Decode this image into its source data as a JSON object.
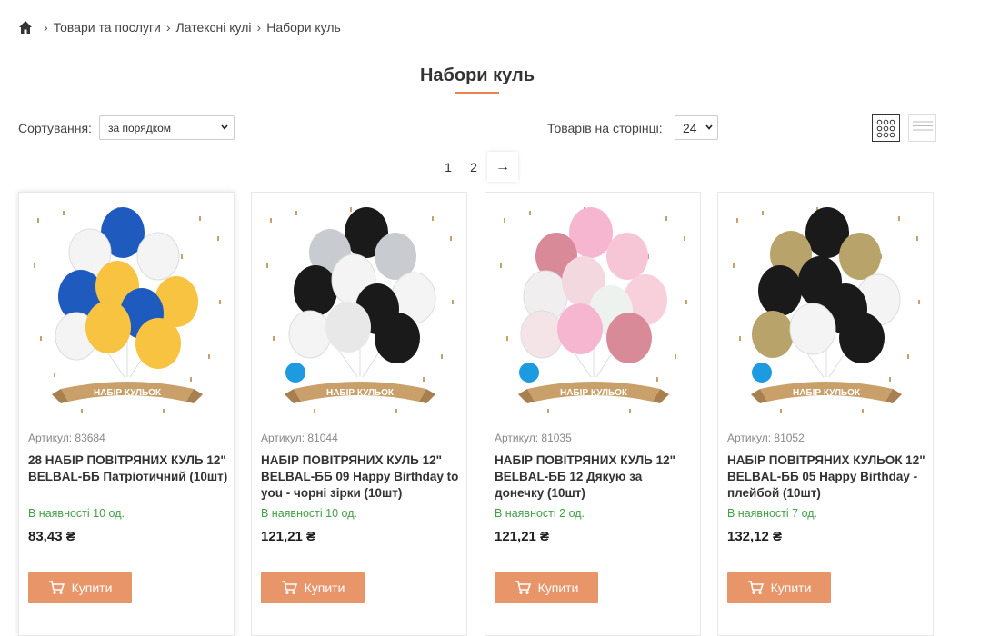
{
  "breadcrumb": {
    "home_icon": "home-icon",
    "items": [
      "Товари та послуги",
      "Латексні кулі",
      "Набори куль"
    ],
    "separator": "›"
  },
  "page": {
    "title": "Набори куль",
    "accent_color": "#e8844d"
  },
  "sorting": {
    "label": "Сортування:",
    "selected": "за порядком"
  },
  "per_page": {
    "label": "Товарів на сторінці:",
    "selected": "24"
  },
  "view_modes": {
    "grid_icon": "grid-view-icon",
    "list_icon": "list-view-icon",
    "active": "grid"
  },
  "pagination": {
    "pages": [
      "1",
      "2"
    ],
    "next": "→"
  },
  "products": [
    {
      "sku": "Артикул: 83684",
      "name": "28 НАБІР ПОВІТРЯНИХ КУЛЬ 12\" BELBAL-ББ Патріотичний (10шт)",
      "stock": "В наявності 10 од.",
      "price": "83,43 ₴",
      "buy": "Купити",
      "banner": "НАБІР КУЛЬОК"
    },
    {
      "sku": "Артикул: 81044",
      "name": "НАБІР ПОВІТРЯНИХ КУЛЬ 12\" BELBAL-ББ 09 Happy Birthday to you - чорні зірки (10шт)",
      "stock": "В наявності 10 од.",
      "price": "121,21 ₴",
      "buy": "Купити",
      "banner": "НАБІР КУЛЬОК"
    },
    {
      "sku": "Артикул: 81035",
      "name": "НАБІР ПОВІТРЯНИХ КУЛЬ 12\" BELBAL-ББ 12 Дякую за донечку (10шт)",
      "stock": "В наявності 2 од.",
      "price": "121,21 ₴",
      "buy": "Купити",
      "banner": "НАБІР КУЛЬОК"
    },
    {
      "sku": "Артикул: 81052",
      "name": "НАБІР ПОВІТРЯНИХ КУЛЬОК 12\" BELBAL-ББ 05 Happy Birthday - плейбой (10шт)",
      "stock": "В наявності 7 од.",
      "price": "132,12 ₴",
      "buy": "Купити",
      "banner": "НАБІР КУЛЬОК"
    }
  ],
  "colors": {
    "buy_button": "#e8956a",
    "in_stock": "#43a047",
    "ribbon": "#c9a06a"
  }
}
